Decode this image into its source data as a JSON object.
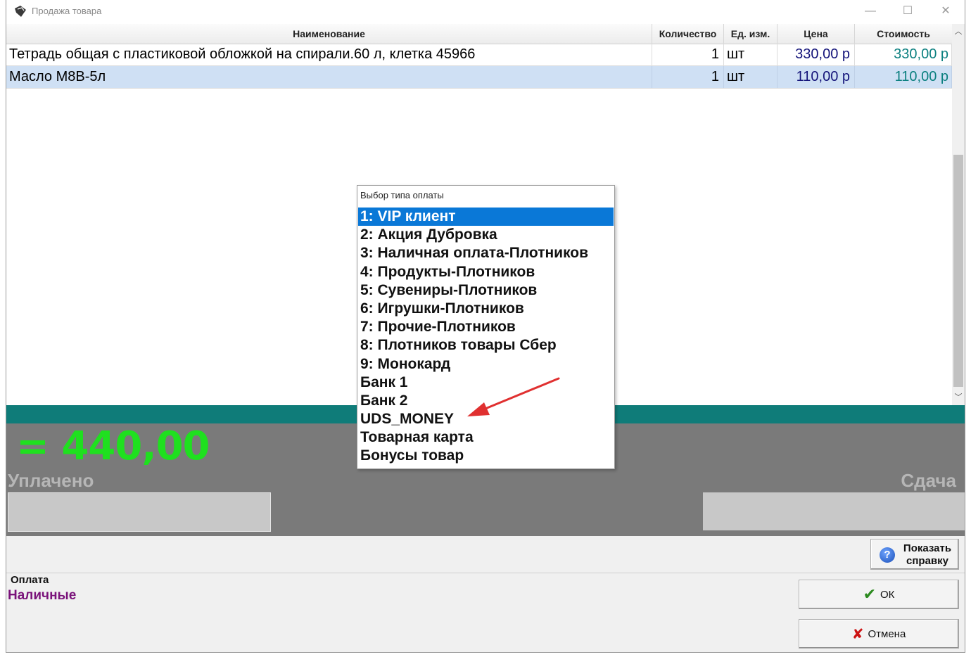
{
  "window": {
    "title": "Продажа товара",
    "minimize": "—",
    "maximize": "☐",
    "close": "✕"
  },
  "grid": {
    "columns": [
      "Наименование",
      "Количество",
      "Ед. изм.",
      "Цена",
      "Стоимость"
    ],
    "rows": [
      {
        "name": "Тетрадь общая с пластиковой обложкой на спирали.60 л, клетка 45966",
        "qty": "1",
        "unit": "шт",
        "price": "330,00 р",
        "cost": "330,00 р"
      },
      {
        "name": "Масло М8В-5л",
        "qty": "1",
        "unit": "шт",
        "price": "110,00 р",
        "cost": "110,00 р"
      }
    ],
    "selected_row": 1
  },
  "totals": {
    "total": "= 440,00",
    "paid_label": "Уплачено",
    "change_label": "Сдача"
  },
  "help_button": {
    "label_line1": "Показать",
    "label_line2": "справку"
  },
  "payment": {
    "label": "Оплата",
    "value": "Наличные"
  },
  "ok_button": {
    "label": "ОК"
  },
  "cancel_button": {
    "label": "Отмена"
  },
  "popup": {
    "title": "Выбор типа оплаты",
    "items": [
      "1: VIP клиент",
      "2: Акция Дубровка",
      "3: Наличная оплата-Плотников",
      "4: Продукты-Плотников",
      "5: Сувениры-Плотников",
      "6: Игрушки-Плотников",
      "7: Прочие-Плотников",
      "8: Плотников товары Сбер",
      "9: Монокард",
      "Банк 1",
      "Банк 2",
      "UDS_MONEY",
      "Товарная карта",
      "Бонусы товар"
    ],
    "selected_index": 0
  },
  "colors": {
    "total_green": "#1fe01f",
    "teal_bar": "#0f7c79",
    "selection_blue": "#0a78d7",
    "payment_purple": "#7a127a",
    "annotation_red": "#e03030"
  }
}
